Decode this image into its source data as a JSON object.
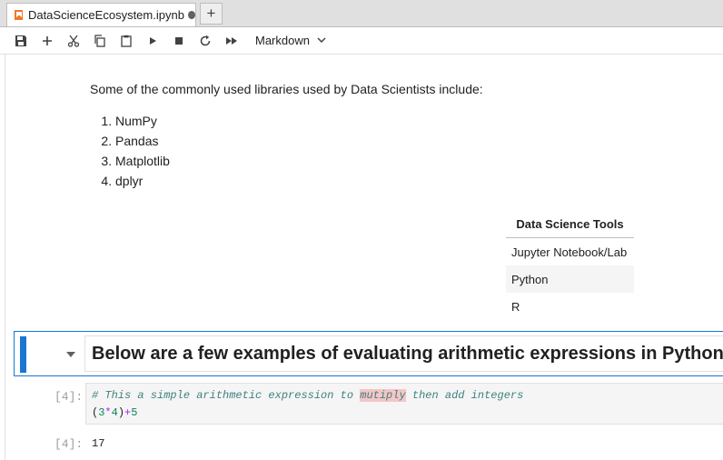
{
  "tab": {
    "title": "DataScienceEcosystem.ipynb",
    "new_tab_label": "+"
  },
  "toolbar": {
    "cell_type": "Markdown"
  },
  "markdown": {
    "intro": "Some of the commonly used libraries used by Data Scientists include:",
    "libraries": [
      "NumPy",
      "Pandas",
      "Matplotlib",
      "dplyr"
    ],
    "table": {
      "header": "Data Science Tools",
      "rows": [
        "Jupyter Notebook/Lab",
        "Python",
        "R"
      ]
    },
    "heading": "Below are a few examples of evaluating arithmetic expressions in Python"
  },
  "code_cell": {
    "prompt": "[4]:",
    "comment_before": "# This a simple arithmetic expression to ",
    "comment_misspelled": "mutiply",
    "comment_after": " then add integers",
    "code": {
      "paren_open": "(",
      "a": "3",
      "mul": "*",
      "b": "4",
      "paren_close": ")",
      "plus": "+",
      "c": "5"
    },
    "output_prompt": "[4]:",
    "output": "17"
  },
  "colors": {
    "accent": "#1976d2",
    "notebook_icon": "#f37726",
    "misspell_highlight": "#f5c6c6"
  }
}
